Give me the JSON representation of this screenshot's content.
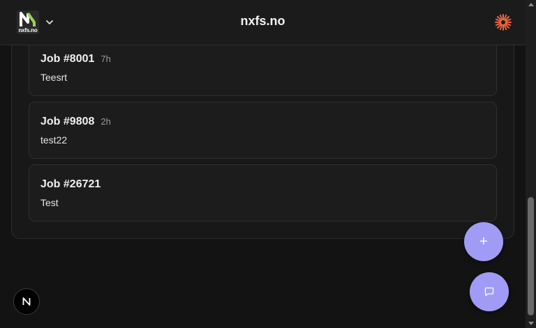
{
  "header": {
    "logo_text": "nxfs.no",
    "title": "nxfs.no"
  },
  "jobs": [
    {
      "number": "Job #8001",
      "age": "7h",
      "description": "Teesrt"
    },
    {
      "number": "Job #9808",
      "age": "2h",
      "description": "test22"
    },
    {
      "number": "Job #26721",
      "age": "",
      "description": "Test"
    }
  ],
  "fabs": {
    "add_symbol": "+"
  },
  "icons": {
    "logo": "nxfs-logo",
    "switcher": "chevron-down-icon",
    "app": "sunburst-icon",
    "add": "plus-icon",
    "chat": "chat-icon",
    "next": "n-logo-icon"
  },
  "colors": {
    "accent": "#a09cf5",
    "brand_green": "#9bd35a",
    "app_icon": "#e8663e"
  }
}
